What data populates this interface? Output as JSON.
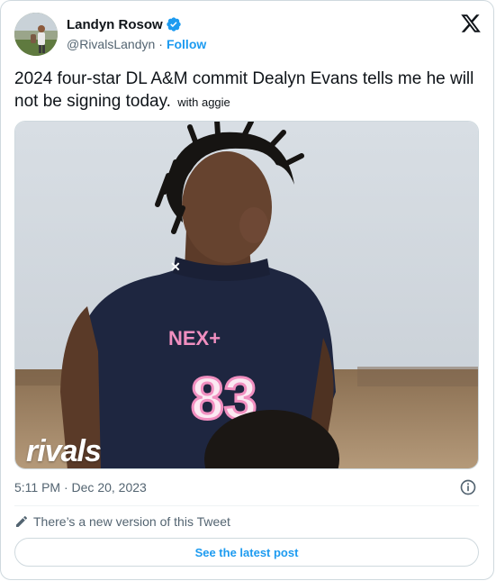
{
  "author": {
    "display_name": "Landyn Rosow",
    "handle": "@RivalsLandyn",
    "separator": "·",
    "follow_label": "Follow"
  },
  "tweet": {
    "text": "2024 four-star DL A&M commit Dealyn Evans tells me he will not be signing today.",
    "extra_text": "with aggie",
    "timestamp": "5:11 PM · Dec 20, 2023"
  },
  "media": {
    "logo_text": "rivals",
    "jersey_brand": "NEX+",
    "jersey_number": "83"
  },
  "notice": {
    "text": "There’s a new version of this Tweet"
  },
  "actions": {
    "latest_label": "See the latest post"
  },
  "colors": {
    "accent": "#1d9bf0",
    "text_primary": "#0f1419",
    "text_secondary": "#536471",
    "border": "#cfd9de",
    "jersey": "#1e2640",
    "jersey_pink": "#f18fc0"
  },
  "icons": {
    "verified": "verified-badge-icon",
    "x_logo": "x-logo-icon",
    "info": "info-icon",
    "pencil": "pencil-icon"
  }
}
